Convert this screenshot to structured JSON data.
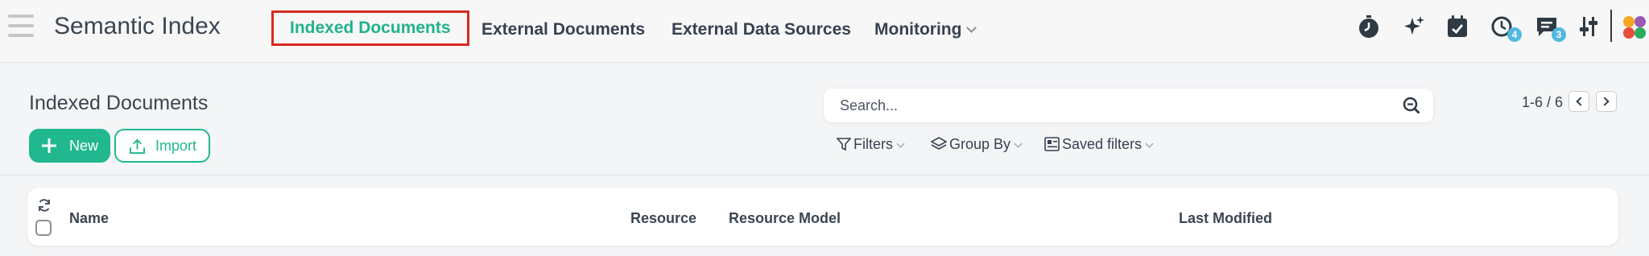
{
  "app": {
    "title": "Semantic Index"
  },
  "nav": {
    "items": [
      {
        "label": "Indexed Documents",
        "active": true
      },
      {
        "label": "External Documents"
      },
      {
        "label": "External Data Sources"
      },
      {
        "label": "Monitoring"
      }
    ]
  },
  "systray": {
    "icons": [
      "stopwatch-icon",
      "sparkle-icon",
      "calendar-check-icon",
      "activity-clock-icon",
      "messages-icon",
      "settings-sliders-icon",
      "app-switcher-icon"
    ],
    "activity_count": "4",
    "messages_count": "3"
  },
  "control_panel": {
    "title": "Indexed Documents",
    "new_label": "New",
    "import_label": "Import",
    "search_placeholder": "Search...",
    "filters_label": "Filters",
    "group_by_label": "Group By",
    "saved_filters_label": "Saved filters",
    "pager": "1-6 / 6"
  },
  "table": {
    "columns": [
      "Name",
      "Resource",
      "Resource Model",
      "Last Modified"
    ]
  },
  "colors": {
    "accent": "#21b88f",
    "highlight_border": "#d8291f",
    "badge": "#52b8e0"
  }
}
